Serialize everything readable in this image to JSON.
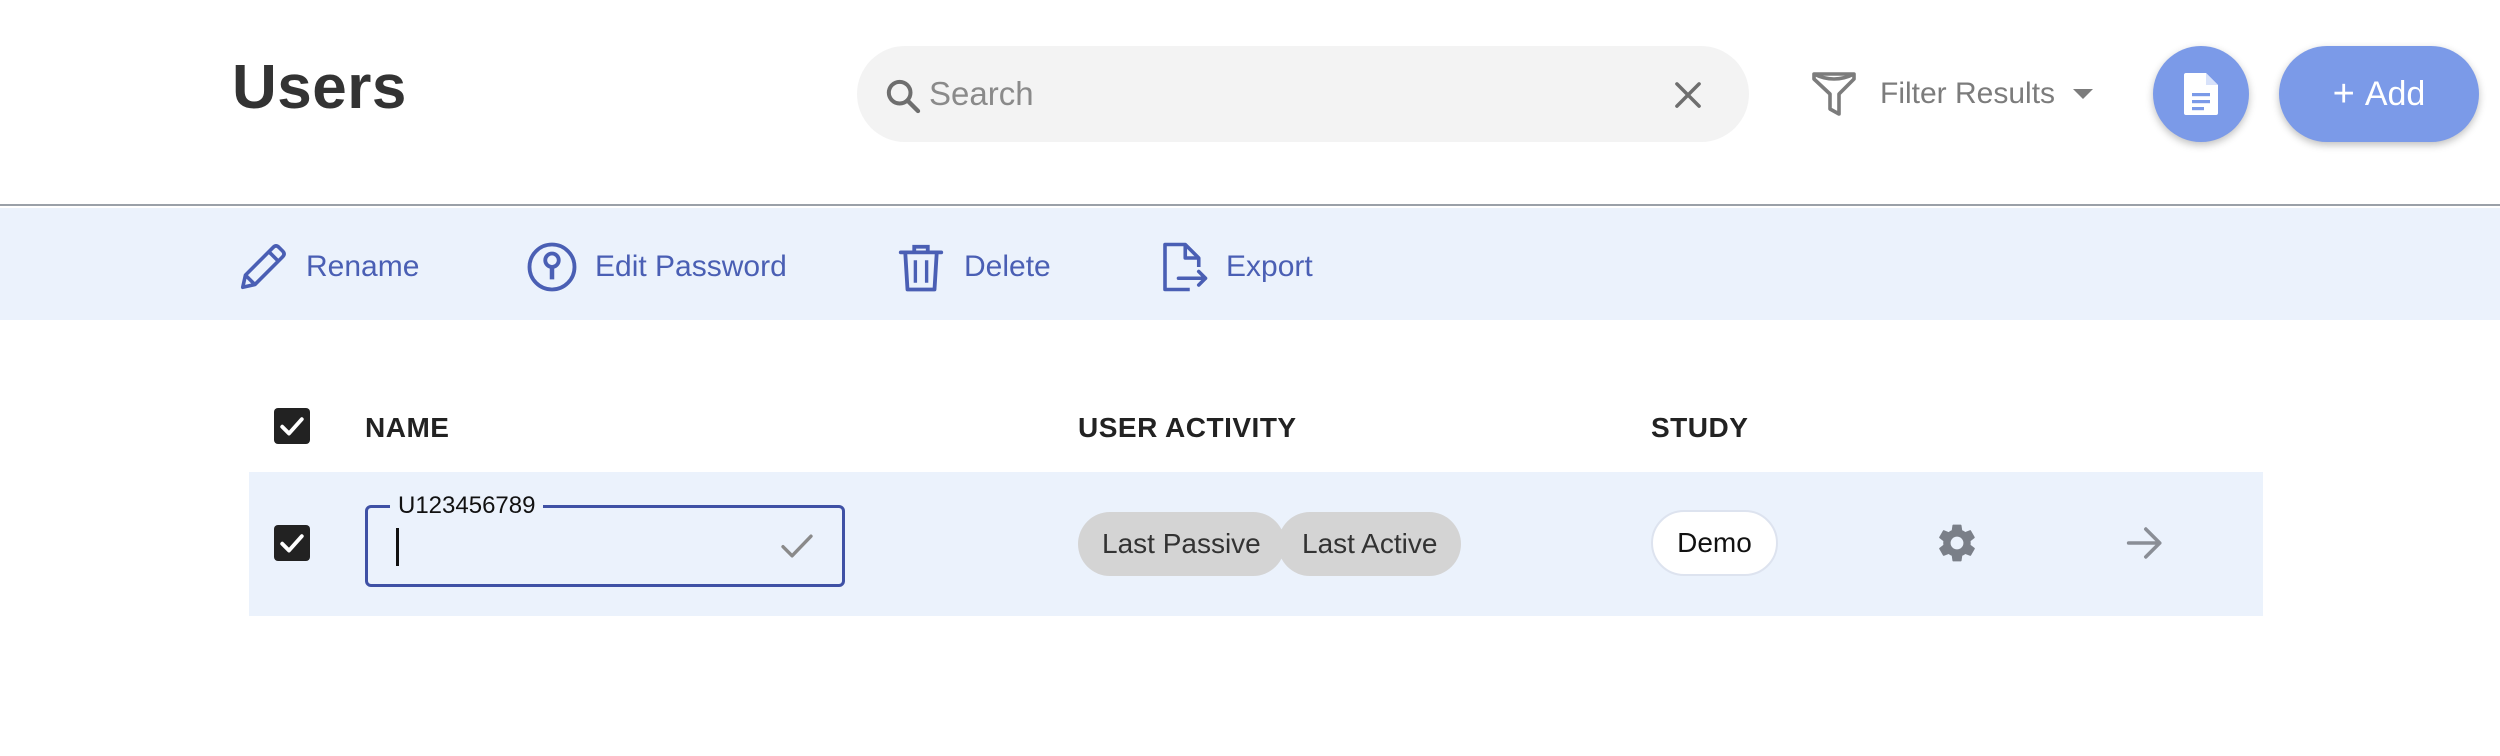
{
  "header": {
    "title": "Users",
    "search": {
      "placeholder": "Search",
      "value": ""
    },
    "filter_label": "Filter Results",
    "add_label": "Add"
  },
  "toolbar": {
    "rename": "Rename",
    "edit_password": "Edit Password",
    "delete": "Delete",
    "export": "Export"
  },
  "table": {
    "columns": {
      "name": "NAME",
      "activity": "USER ACTIVITY",
      "study": "STUDY"
    },
    "rows": [
      {
        "checked": true,
        "name_field_label": "U123456789",
        "name_value": "",
        "activity": [
          "Last Passive",
          "Last Active"
        ],
        "study": "Demo"
      }
    ]
  },
  "colors": {
    "accent": "#7b9ae8",
    "toolbar_bg": "#ebf2fc",
    "toolbar_text": "#4a5fb4",
    "field_border": "#3f51a5"
  },
  "icons": {
    "search": "search-icon",
    "clear": "close-icon",
    "filter": "filter-icon",
    "report": "document-icon",
    "rename": "pencil-icon",
    "password": "keyhole-icon",
    "delete": "trash-icon",
    "export": "file-export-icon",
    "settings": "gear-icon",
    "open": "arrow-right-icon"
  }
}
